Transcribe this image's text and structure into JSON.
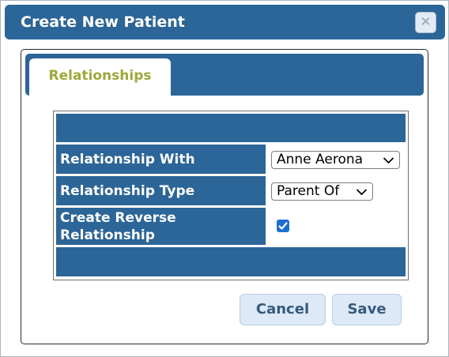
{
  "dialog": {
    "title": "Create New Patient",
    "close_icon": "close-icon"
  },
  "tabs": [
    {
      "label": "Relationships",
      "active": true
    }
  ],
  "form": {
    "relationship_with": {
      "label": "Relationship With",
      "value": "Anne Aerona"
    },
    "relationship_type": {
      "label": "Relationship Type",
      "value": "Parent Of"
    },
    "create_reverse": {
      "label": "Create Reverse Relationship",
      "checked": true
    }
  },
  "buttons": {
    "cancel": "Cancel",
    "save": "Save"
  },
  "colors": {
    "header_blue": "#2c6597",
    "tab_text": "#9da83a",
    "button_bg": "#dde9f6",
    "button_text": "#355a7f",
    "checkbox": "#1f6fd1"
  }
}
